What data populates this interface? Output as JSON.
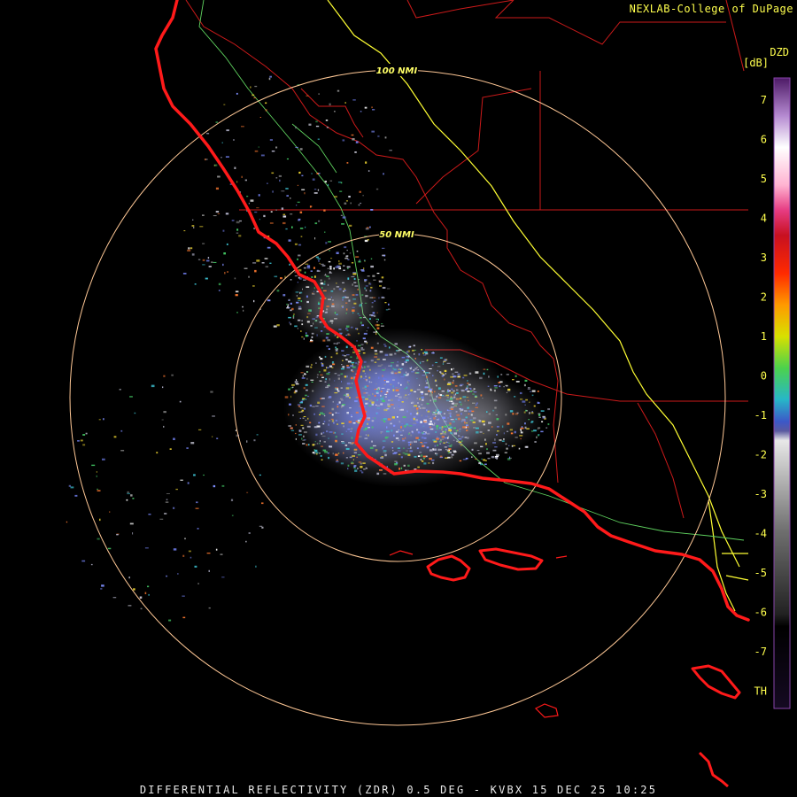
{
  "header": {
    "credit": "NEXLAB-College of DuPage"
  },
  "footer": {
    "caption": "DIFFERENTIAL REFLECTIVITY (ZDR) 0.5 DEG - KVBX 15 DEC 25 10:25"
  },
  "rings": {
    "inner_label": "50 NMI",
    "outer_label": "100 NMI"
  },
  "legend": {
    "product": "DZD",
    "unit": "[dB]",
    "ticks": [
      "7",
      "6",
      "5",
      "4",
      "3",
      "2",
      "1",
      "0",
      "-1",
      "-2",
      "-3",
      "-4",
      "-5",
      "-6",
      "-7",
      "TH"
    ]
  },
  "colors": {
    "background": "#000000",
    "coastline": "#ff1a1a",
    "county_lines": "#cc1a1a",
    "highway": "#ffff33",
    "rivers": "#5fd35f",
    "range_rings": "#ffc896",
    "label_text": "#ffff4d"
  }
}
